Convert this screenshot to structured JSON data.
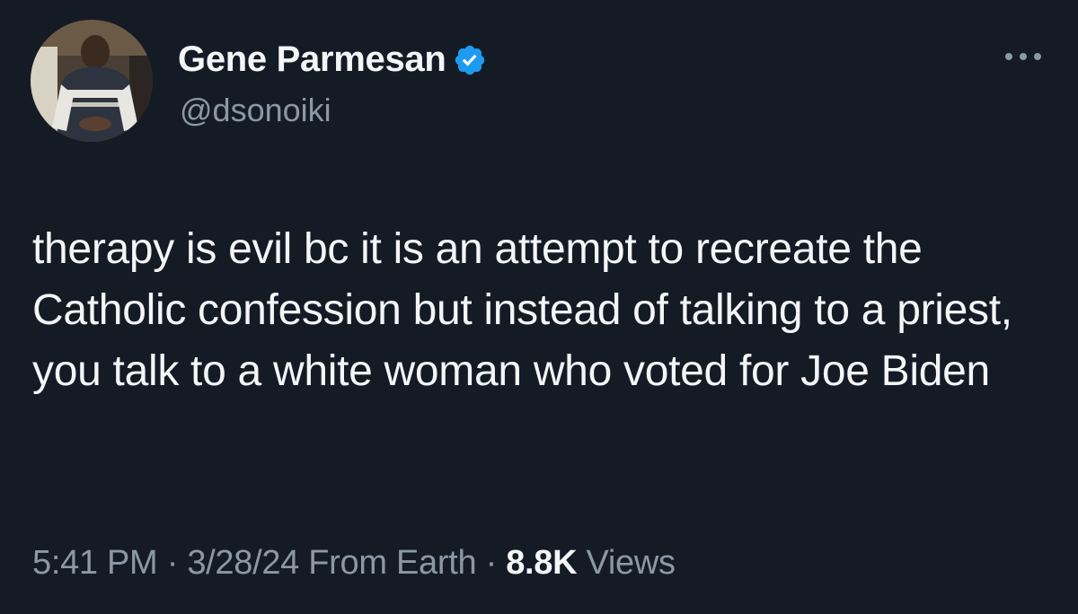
{
  "author": {
    "display_name": "Gene Parmesan",
    "handle": "@dsonoiki",
    "verified": true,
    "verified_color": "#1d9bf0"
  },
  "icons": {
    "verified": "verified-badge-icon",
    "more": "more-options-icon"
  },
  "tweet": {
    "text": "therapy is evil bc it is an attempt to recreate the Catholic confession but instead of talking to a priest, you talk to a white woman who voted for Joe Biden"
  },
  "meta": {
    "time": "5:41 PM",
    "separator": "·",
    "date": "3/28/24",
    "source": "From Earth",
    "views_count": "8.8K",
    "views_label": "Views"
  },
  "colors": {
    "background": "#151b25",
    "text": "#f3f5f7",
    "secondary_text": "#8b98a5"
  }
}
